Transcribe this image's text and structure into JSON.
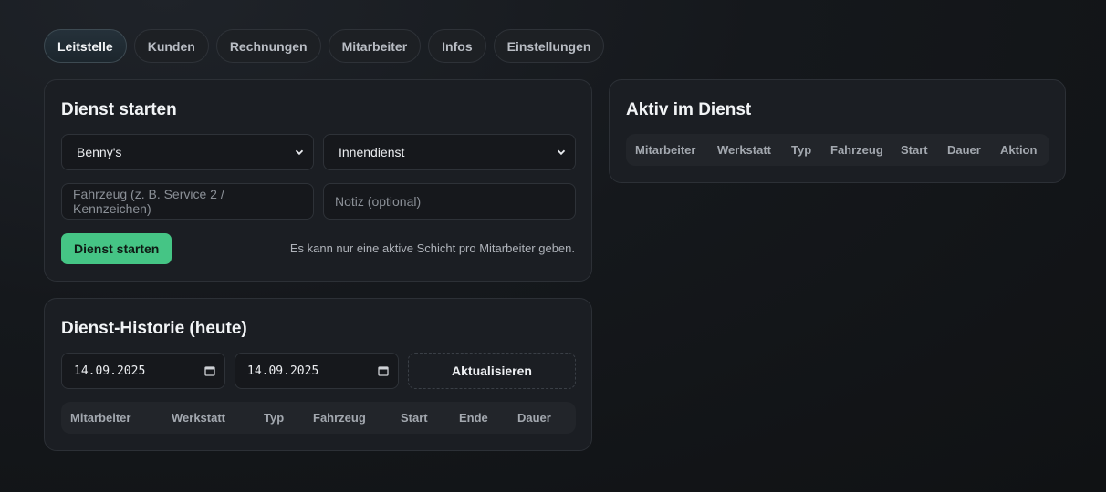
{
  "tabs": [
    {
      "label": "Leitstelle",
      "active": true
    },
    {
      "label": "Kunden"
    },
    {
      "label": "Rechnungen"
    },
    {
      "label": "Mitarbeiter"
    },
    {
      "label": "Infos"
    },
    {
      "label": "Einstellungen"
    }
  ],
  "start_panel": {
    "title": "Dienst starten",
    "workshop_select": "Benny's",
    "type_select": "Innendienst",
    "vehicle_placeholder": "Fahrzeug (z. B. Service 2 / Kennzeichen)",
    "note_placeholder": "Notiz (optional)",
    "start_button": "Dienst starten",
    "hint": "Es kann nur eine aktive Schicht pro Mitarbeiter geben."
  },
  "history_panel": {
    "title": "Dienst-Historie (heute)",
    "date_from": "14.09.2025",
    "date_to": "14.09.2025",
    "refresh_button": "Aktualisieren",
    "columns": [
      "Mitarbeiter",
      "Werkstatt",
      "Typ",
      "Fahrzeug",
      "Start",
      "Ende",
      "Dauer"
    ]
  },
  "active_panel": {
    "title": "Aktiv im Dienst",
    "columns": [
      "Mitarbeiter",
      "Werkstatt",
      "Typ",
      "Fahrzeug",
      "Start",
      "Dauer",
      "Aktion"
    ]
  },
  "colors": {
    "accent_green": "#45c585",
    "panel_bg": "#1b1e23",
    "page_bg": "#15181c"
  },
  "icons": {
    "select_arrow": "chevron-down-icon",
    "date_picker": "calendar-icon"
  }
}
